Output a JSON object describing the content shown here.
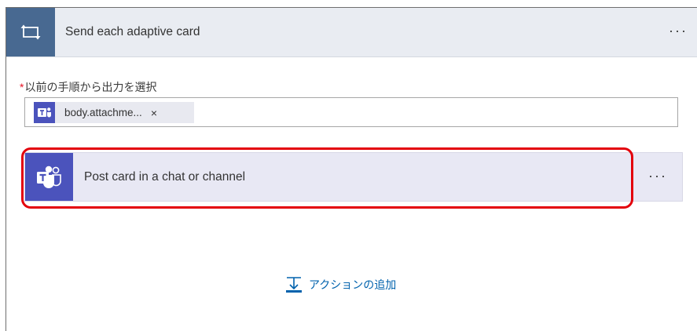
{
  "foreach": {
    "title": "Send each adaptive card",
    "more_label": "···",
    "icon": "loop-icon",
    "accent_color": "#486991"
  },
  "select_output": {
    "required_marker": "*",
    "label": "以前の手順から出力を選択",
    "token": {
      "icon": "teams-icon",
      "text": "body.attachme...",
      "remove_label": "×"
    }
  },
  "action": {
    "title": "Post card in a chat or channel",
    "more_label": "···",
    "icon": "teams-icon",
    "accent_color": "#4b53bc",
    "highlight_color": "#e3000b"
  },
  "add_action": {
    "label": "アクションの追加",
    "icon": "insert-step-icon",
    "color": "#0062ad"
  }
}
